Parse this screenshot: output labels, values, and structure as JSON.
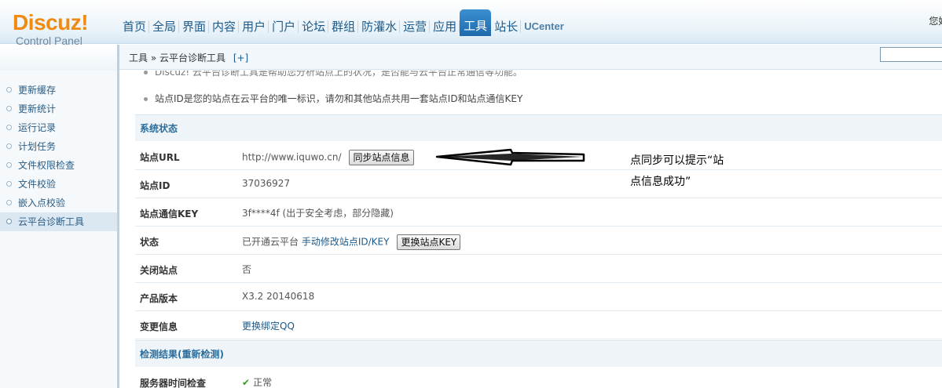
{
  "logo": {
    "word": "Discuz!",
    "sub": "Control Panel"
  },
  "nav": [
    {
      "label": "首页",
      "name": "nav-home"
    },
    {
      "label": "全局",
      "name": "nav-global"
    },
    {
      "label": "界面",
      "name": "nav-style"
    },
    {
      "label": "内容",
      "name": "nav-content"
    },
    {
      "label": "用户",
      "name": "nav-user"
    },
    {
      "label": "门户",
      "name": "nav-portal"
    },
    {
      "label": "论坛",
      "name": "nav-forum"
    },
    {
      "label": "群组",
      "name": "nav-group"
    },
    {
      "label": "防灌水",
      "name": "nav-safe"
    },
    {
      "label": "运营",
      "name": "nav-extended"
    },
    {
      "label": "应用",
      "name": "nav-plugin"
    },
    {
      "label": "工具",
      "name": "nav-tools",
      "active": true
    },
    {
      "label": "站长",
      "name": "nav-founder"
    },
    {
      "label": "UCenter",
      "name": "nav-ucenter"
    }
  ],
  "user": {
    "greeting": "您好, ad"
  },
  "breadcrumb": {
    "path": "工具 » 云平台诊断工具",
    "plus": "[+]"
  },
  "sidebar": {
    "items": [
      {
        "label": "更新缓存"
      },
      {
        "label": "更新统计"
      },
      {
        "label": "运行记录"
      },
      {
        "label": "计划任务"
      },
      {
        "label": "文件权限检查"
      },
      {
        "label": "文件校验"
      },
      {
        "label": "嵌入点校验"
      },
      {
        "label": "云平台诊断工具",
        "active": true
      }
    ]
  },
  "tips": {
    "t1": "Discuz! 云平台诊断工具是帮助您分析站点上的状况，是否能与云平台正常通信等功能。",
    "t2": "站点ID是您的站点在云平台的唯一标识，请勿和其他站点共用一套站点ID和站点通信KEY"
  },
  "system": {
    "heading": "系统状态",
    "site_url_label": "站点URL",
    "site_url": "http://www.iquwo.cn/",
    "sync_button": "同步站点信息",
    "site_id_label": "站点ID",
    "site_id": "37036927",
    "site_key_label": "站点通信KEY",
    "site_key": "3f****4f (出于安全考虑，部分隐藏)",
    "status_label": "状态",
    "status_text": "已开通云平台",
    "status_link": "手动修改站点ID/KEY",
    "change_key_button": "更换站点KEY",
    "closed_label": "关闭站点",
    "closed_value": "否",
    "version_label": "产品版本",
    "version_value": "X3.2 20140618",
    "change_label": "变更信息",
    "change_link": "更换绑定QQ"
  },
  "check": {
    "heading": "检测结果(重新检测)",
    "time_label": "服务器时间检查",
    "time_status": "正常"
  },
  "annotation": {
    "line1": "点同步可以提示“站",
    "line2": "点信息成功”"
  }
}
